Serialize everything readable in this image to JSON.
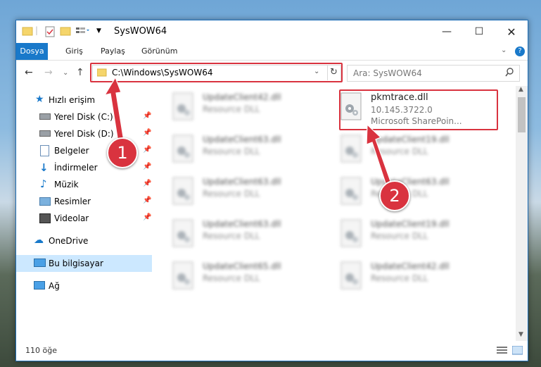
{
  "window": {
    "title": "SysWOW64"
  },
  "ribbon": {
    "tabs": [
      "Dosya",
      "Giriş",
      "Paylaş",
      "Görünüm"
    ]
  },
  "address": {
    "path": "C:\\Windows\\SysWOW64"
  },
  "search": {
    "placeholder": "Ara: SysWOW64"
  },
  "sidebar": {
    "items": [
      {
        "label": "Hızlı erişim",
        "icon": "star-icon"
      },
      {
        "label": "Yerel Disk (C:)",
        "icon": "drive-icon",
        "pinned": true
      },
      {
        "label": "Yerel Disk (D:)",
        "icon": "drive-icon",
        "pinned": true
      },
      {
        "label": "Belgeler",
        "icon": "documents-icon",
        "pinned": true
      },
      {
        "label": "İndirmeler",
        "icon": "download-icon",
        "pinned": true
      },
      {
        "label": "Müzik",
        "icon": "music-icon",
        "pinned": true
      },
      {
        "label": "Resimler",
        "icon": "pictures-icon",
        "pinned": true
      },
      {
        "label": "Videolar",
        "icon": "videos-icon",
        "pinned": true
      },
      {
        "label": "OneDrive",
        "icon": "cloud-icon"
      },
      {
        "label": "Bu bilgisayar",
        "icon": "computer-icon",
        "selected": true
      },
      {
        "label": "Ağ",
        "icon": "network-icon"
      }
    ]
  },
  "files": {
    "left": [
      {
        "name": "UpdateClient42.dll",
        "type": "Resource DLL"
      },
      {
        "name": "UpdateClient63.dll",
        "type": "Resource DLL"
      },
      {
        "name": "UpdateClient63.dll",
        "type": "Resource DLL"
      },
      {
        "name": "UpdateClient63.dll",
        "type": "Resource DLL"
      },
      {
        "name": "UpdateClient65.dll",
        "type": "Resource DLL"
      }
    ],
    "right": [
      {
        "name": "pkmtrace.dll",
        "version": "10.145.3722.0",
        "type": "Microsoft SharePoin..."
      },
      {
        "name": "UpdateClient19.dll",
        "type": "Resource DLL"
      },
      {
        "name": "UpdateClient63.dll",
        "type": "Resource DLL"
      },
      {
        "name": "UpdateClient19.dll",
        "type": "Resource DLL"
      },
      {
        "name": "UpdateClient42.dll",
        "type": "Resource DLL"
      }
    ]
  },
  "status": {
    "count": "110 öğe"
  },
  "callouts": [
    "1",
    "2"
  ],
  "colors": {
    "accent": "#1979ca",
    "highlight": "#d9333f",
    "selected_bg": "#cce8ff"
  }
}
